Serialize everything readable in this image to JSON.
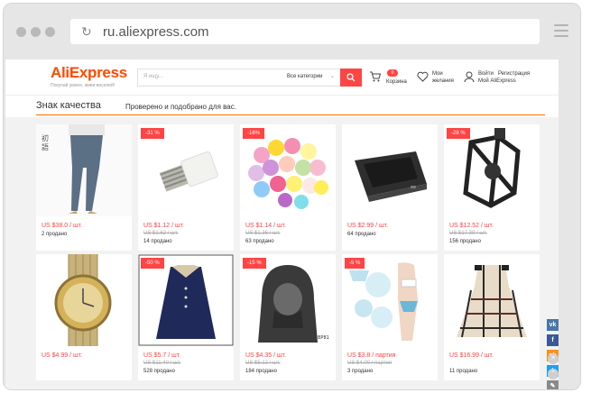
{
  "browser": {
    "url": "ru.aliexpress.com"
  },
  "header": {
    "logo": "AliExpress",
    "tagline": "Покупай умнее, живи веселей!",
    "search_placeholder": "Я ищу...",
    "category": "Все категории",
    "cart_count": "0",
    "cart_label": "Корзина",
    "wish_line1": "Мои",
    "wish_line2": "желания",
    "login": "Войти",
    "register": "Регистрация",
    "my_ali": "Мой AliExpress"
  },
  "section": {
    "title": "Знак качества",
    "subtitle": "Проверено и подобрано для вас."
  },
  "products": [
    {
      "price": "US $38.0 / шт.",
      "old_price": "",
      "sold": "2 продано",
      "discount": ""
    },
    {
      "price": "US $1.12 / шт.",
      "old_price": "US $1.62 / шт.",
      "sold": "14 продано",
      "discount": "-31 %"
    },
    {
      "price": "US $1.14 / шт.",
      "old_price": "US $1.36 / шт.",
      "sold": "63 продано",
      "discount": "-16%"
    },
    {
      "price": "US $2.99 / шт.",
      "old_price": "",
      "sold": "64 продано",
      "discount": ""
    },
    {
      "price": "US $12.52 / шт.",
      "old_price": "US $17.39 / шт.",
      "sold": "156 продано",
      "discount": "-28 %"
    },
    {
      "price": "US $4.99 / шт.",
      "old_price": "",
      "sold": "",
      "discount": ""
    },
    {
      "price": "US $5.7 / шт.",
      "old_price": "US $11.40 / шт.",
      "sold": "528 продано",
      "discount": "-50 %"
    },
    {
      "price": "US $4.35 / шт.",
      "old_price": "US $5.12 / шт.",
      "sold": "184 продано",
      "discount": "-15 %"
    },
    {
      "price": "US $3.8 / партия",
      "old_price": "US $4.00 / партия",
      "sold": "3 продано",
      "discount": "-5 %"
    },
    {
      "price": "US $16.99 / шт.",
      "old_price": "",
      "sold": "11 продано",
      "discount": ""
    }
  ],
  "social": [
    "vk-icon",
    "facebook-icon",
    "odnoklassniki-icon",
    "twitter-icon",
    "edit-icon"
  ],
  "colors": {
    "accent": "#ff4a00",
    "price": "#ff4444",
    "badge": "#ff4444"
  }
}
